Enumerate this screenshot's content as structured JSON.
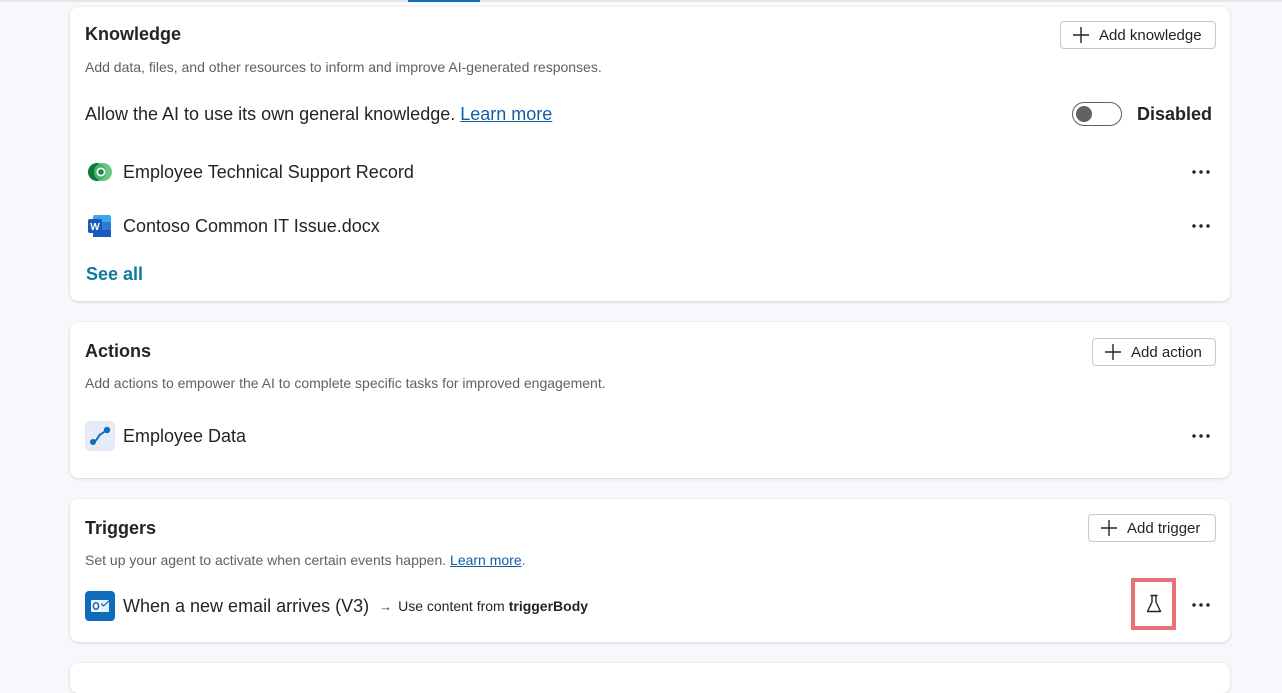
{
  "knowledge": {
    "title": "Knowledge",
    "add_label": "Add knowledge",
    "description": "Add data, files, and other resources to inform and improve AI-generated responses.",
    "general_knowledge_text": "Allow the AI to use its own general knowledge.",
    "learn_more": "Learn more",
    "toggle_state": "Disabled",
    "toggle_on": false,
    "items": [
      {
        "label": "Employee Technical Support Record",
        "icon": "dataverse-icon"
      },
      {
        "label": "Contoso Common IT Issue.docx",
        "icon": "word-icon"
      }
    ],
    "see_all": "See all"
  },
  "actions": {
    "title": "Actions",
    "add_label": "Add action",
    "description": "Add actions to empower the AI to complete specific tasks for improved engagement.",
    "items": [
      {
        "label": "Employee Data",
        "icon": "connector-icon"
      }
    ]
  },
  "triggers": {
    "title": "Triggers",
    "add_label": "Add trigger",
    "description": "Set up your agent to activate when certain events happen.",
    "learn_more": "Learn more",
    "period": ".",
    "items": [
      {
        "label": "When a new email arrives (V3)",
        "arrow": "→",
        "detail_prefix": "Use content from",
        "detail_bold": "triggerBody",
        "icon": "outlook-icon"
      }
    ]
  },
  "colors": {
    "accent": "#0f6cbd",
    "link": "#115ea3",
    "see_all": "#0f7ba0",
    "highlight": "#e8727a"
  }
}
